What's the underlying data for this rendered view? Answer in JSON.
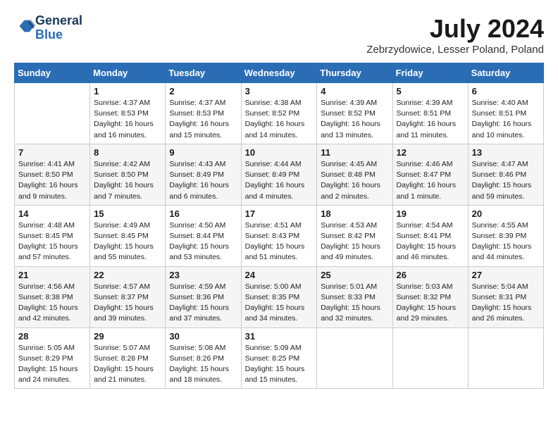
{
  "header": {
    "logo_line1": "General",
    "logo_line2": "Blue",
    "month_year": "July 2024",
    "location": "Zebrzydowice, Lesser Poland, Poland"
  },
  "days_of_week": [
    "Sunday",
    "Monday",
    "Tuesday",
    "Wednesday",
    "Thursday",
    "Friday",
    "Saturday"
  ],
  "weeks": [
    [
      {
        "num": "",
        "info": ""
      },
      {
        "num": "1",
        "info": "Sunrise: 4:37 AM\nSunset: 8:53 PM\nDaylight: 16 hours\nand 16 minutes."
      },
      {
        "num": "2",
        "info": "Sunrise: 4:37 AM\nSunset: 8:53 PM\nDaylight: 16 hours\nand 15 minutes."
      },
      {
        "num": "3",
        "info": "Sunrise: 4:38 AM\nSunset: 8:52 PM\nDaylight: 16 hours\nand 14 minutes."
      },
      {
        "num": "4",
        "info": "Sunrise: 4:39 AM\nSunset: 8:52 PM\nDaylight: 16 hours\nand 13 minutes."
      },
      {
        "num": "5",
        "info": "Sunrise: 4:39 AM\nSunset: 8:51 PM\nDaylight: 16 hours\nand 11 minutes."
      },
      {
        "num": "6",
        "info": "Sunrise: 4:40 AM\nSunset: 8:51 PM\nDaylight: 16 hours\nand 10 minutes."
      }
    ],
    [
      {
        "num": "7",
        "info": "Sunrise: 4:41 AM\nSunset: 8:50 PM\nDaylight: 16 hours\nand 9 minutes."
      },
      {
        "num": "8",
        "info": "Sunrise: 4:42 AM\nSunset: 8:50 PM\nDaylight: 16 hours\nand 7 minutes."
      },
      {
        "num": "9",
        "info": "Sunrise: 4:43 AM\nSunset: 8:49 PM\nDaylight: 16 hours\nand 6 minutes."
      },
      {
        "num": "10",
        "info": "Sunrise: 4:44 AM\nSunset: 8:49 PM\nDaylight: 16 hours\nand 4 minutes."
      },
      {
        "num": "11",
        "info": "Sunrise: 4:45 AM\nSunset: 8:48 PM\nDaylight: 16 hours\nand 2 minutes."
      },
      {
        "num": "12",
        "info": "Sunrise: 4:46 AM\nSunset: 8:47 PM\nDaylight: 16 hours\nand 1 minute."
      },
      {
        "num": "13",
        "info": "Sunrise: 4:47 AM\nSunset: 8:46 PM\nDaylight: 15 hours\nand 59 minutes."
      }
    ],
    [
      {
        "num": "14",
        "info": "Sunrise: 4:48 AM\nSunset: 8:45 PM\nDaylight: 15 hours\nand 57 minutes."
      },
      {
        "num": "15",
        "info": "Sunrise: 4:49 AM\nSunset: 8:45 PM\nDaylight: 15 hours\nand 55 minutes."
      },
      {
        "num": "16",
        "info": "Sunrise: 4:50 AM\nSunset: 8:44 PM\nDaylight: 15 hours\nand 53 minutes."
      },
      {
        "num": "17",
        "info": "Sunrise: 4:51 AM\nSunset: 8:43 PM\nDaylight: 15 hours\nand 51 minutes."
      },
      {
        "num": "18",
        "info": "Sunrise: 4:53 AM\nSunset: 8:42 PM\nDaylight: 15 hours\nand 49 minutes."
      },
      {
        "num": "19",
        "info": "Sunrise: 4:54 AM\nSunset: 8:41 PM\nDaylight: 15 hours\nand 46 minutes."
      },
      {
        "num": "20",
        "info": "Sunrise: 4:55 AM\nSunset: 8:39 PM\nDaylight: 15 hours\nand 44 minutes."
      }
    ],
    [
      {
        "num": "21",
        "info": "Sunrise: 4:56 AM\nSunset: 8:38 PM\nDaylight: 15 hours\nand 42 minutes."
      },
      {
        "num": "22",
        "info": "Sunrise: 4:57 AM\nSunset: 8:37 PM\nDaylight: 15 hours\nand 39 minutes."
      },
      {
        "num": "23",
        "info": "Sunrise: 4:59 AM\nSunset: 8:36 PM\nDaylight: 15 hours\nand 37 minutes."
      },
      {
        "num": "24",
        "info": "Sunrise: 5:00 AM\nSunset: 8:35 PM\nDaylight: 15 hours\nand 34 minutes."
      },
      {
        "num": "25",
        "info": "Sunrise: 5:01 AM\nSunset: 8:33 PM\nDaylight: 15 hours\nand 32 minutes."
      },
      {
        "num": "26",
        "info": "Sunrise: 5:03 AM\nSunset: 8:32 PM\nDaylight: 15 hours\nand 29 minutes."
      },
      {
        "num": "27",
        "info": "Sunrise: 5:04 AM\nSunset: 8:31 PM\nDaylight: 15 hours\nand 26 minutes."
      }
    ],
    [
      {
        "num": "28",
        "info": "Sunrise: 5:05 AM\nSunset: 8:29 PM\nDaylight: 15 hours\nand 24 minutes."
      },
      {
        "num": "29",
        "info": "Sunrise: 5:07 AM\nSunset: 8:28 PM\nDaylight: 15 hours\nand 21 minutes."
      },
      {
        "num": "30",
        "info": "Sunrise: 5:08 AM\nSunset: 8:26 PM\nDaylight: 15 hours\nand 18 minutes."
      },
      {
        "num": "31",
        "info": "Sunrise: 5:09 AM\nSunset: 8:25 PM\nDaylight: 15 hours\nand 15 minutes."
      },
      {
        "num": "",
        "info": ""
      },
      {
        "num": "",
        "info": ""
      },
      {
        "num": "",
        "info": ""
      }
    ]
  ]
}
